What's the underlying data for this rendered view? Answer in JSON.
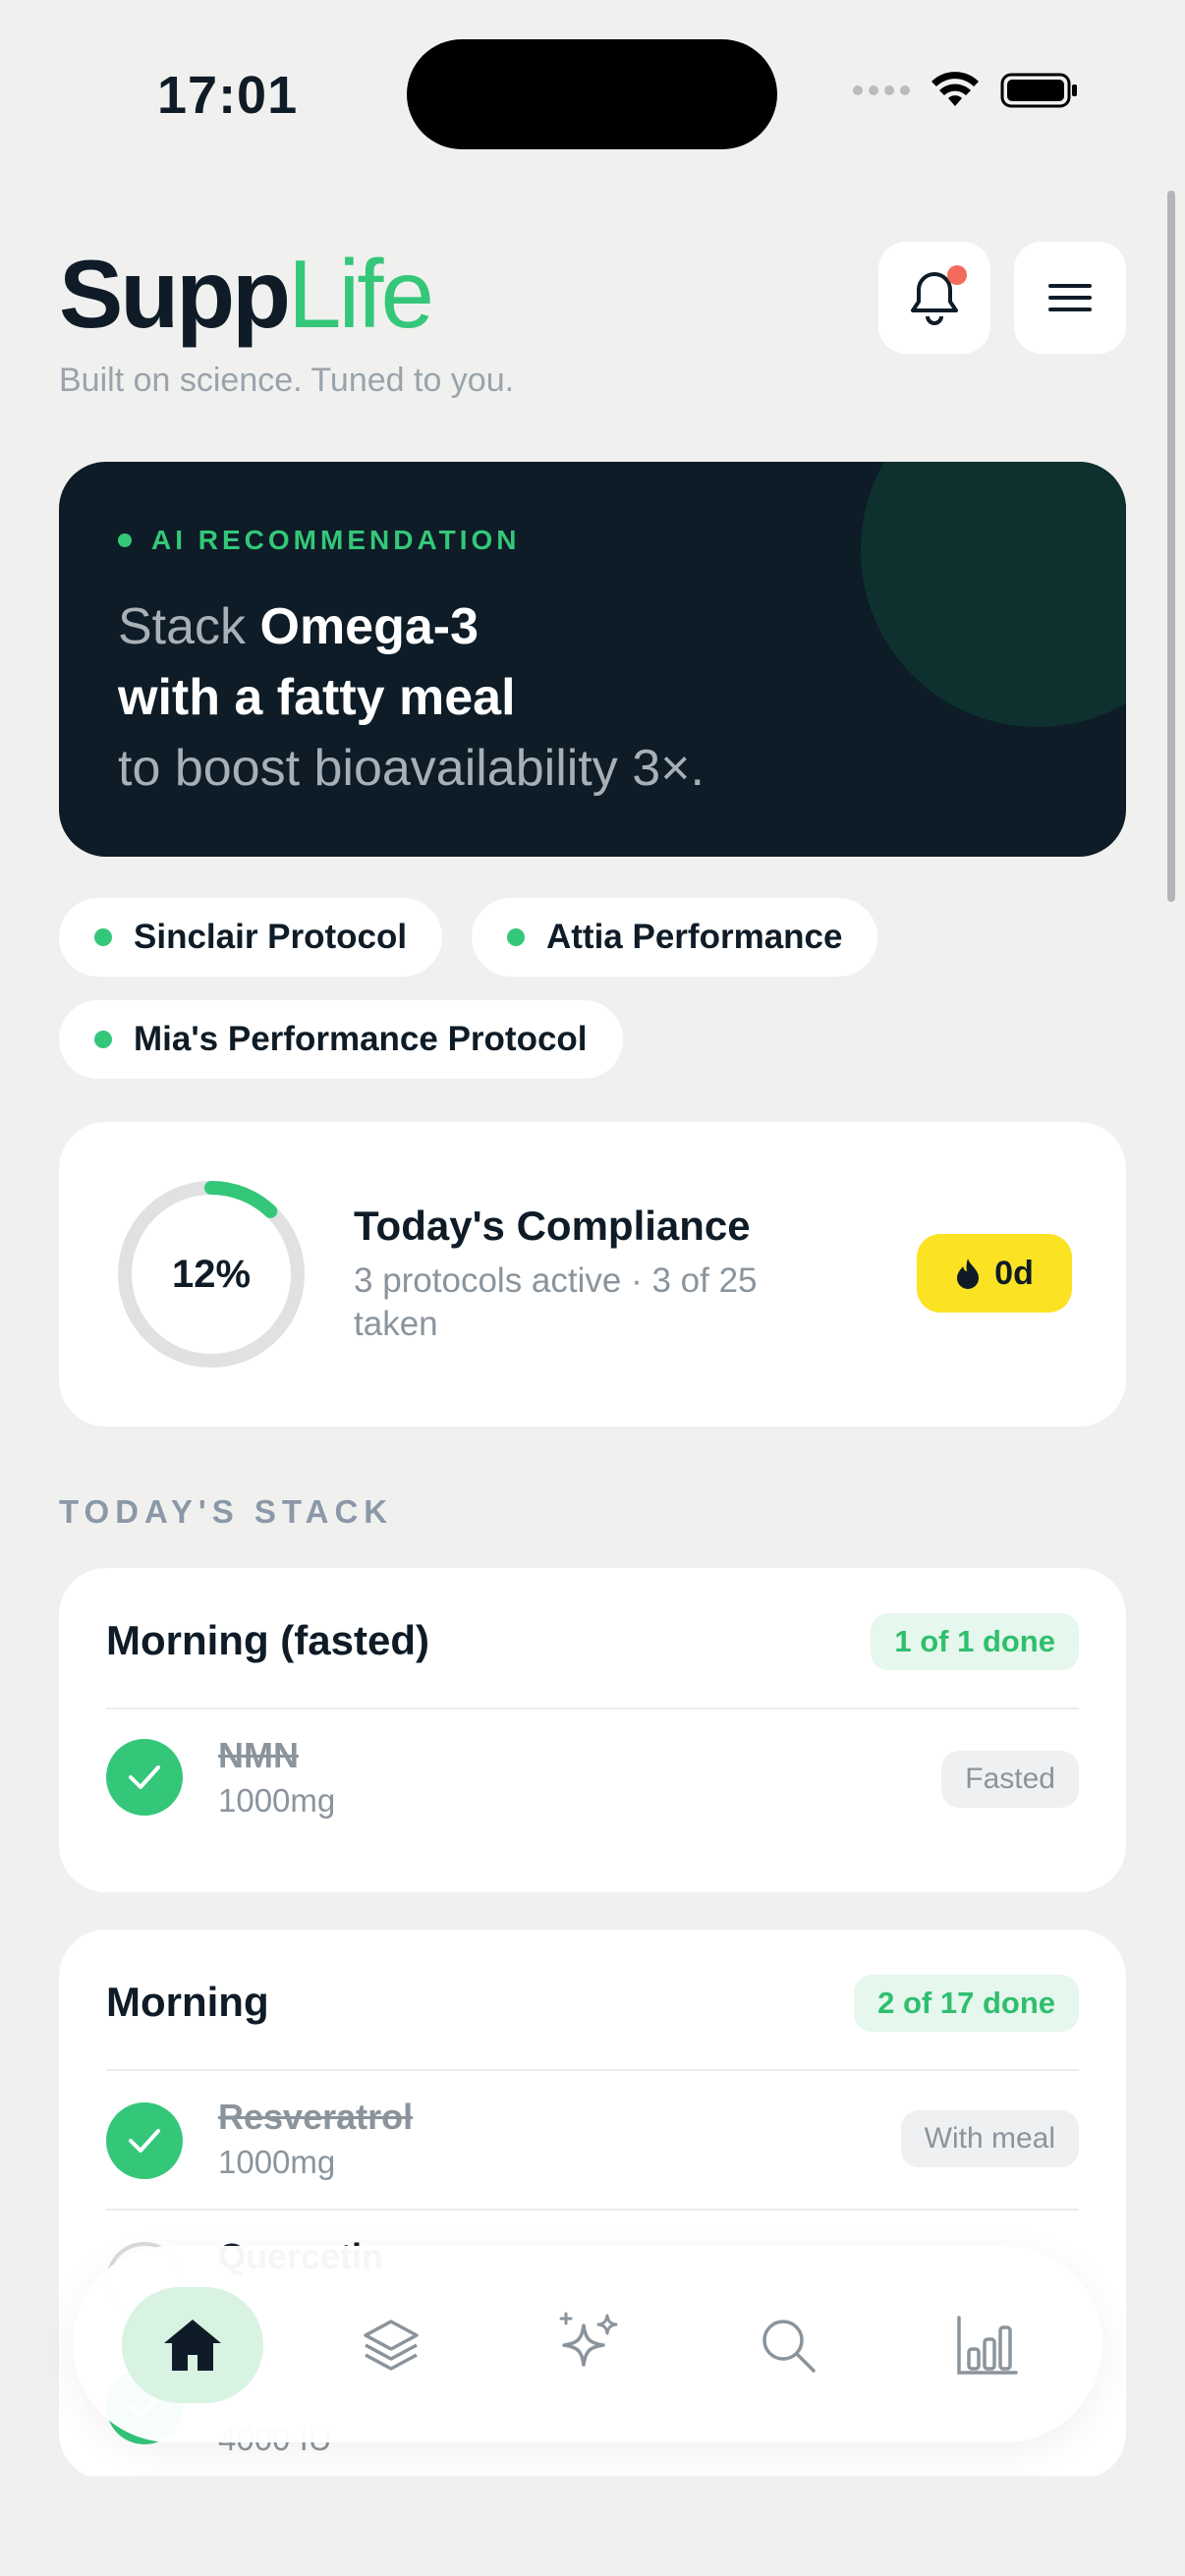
{
  "status_bar": {
    "time": "17:01"
  },
  "header": {
    "brand_bold": "Supp",
    "brand_light": "Life",
    "tagline": "Built on science. Tuned to you."
  },
  "ai_card": {
    "label": "AI RECOMMENDATION",
    "line1_prefix": "Stack ",
    "line1_bold": "Omega-3",
    "line2_bold": "with a fatty meal",
    "line3": "to boost bioavailability 3×."
  },
  "protocols": [
    {
      "label": "Sinclair Protocol"
    },
    {
      "label": "Attia Performance"
    },
    {
      "label": "Mia's Performance Protocol"
    }
  ],
  "compliance": {
    "percent_label": "12%",
    "percent_value": 12,
    "title": "Today's Compliance",
    "subtitle": "3 protocols active · 3 of 25 taken",
    "streak": "0d"
  },
  "section_title": "TODAY'S STACK",
  "stack": [
    {
      "slot": "Morning (fasted)",
      "badge": "1 of 1 done",
      "items": [
        {
          "name": "NMN",
          "dose": "1000mg",
          "tag": "Fasted",
          "done": true
        }
      ]
    },
    {
      "slot": "Morning",
      "badge": "2 of 17 done",
      "items": [
        {
          "name": "Resveratrol",
          "dose": "1000mg",
          "tag": "With meal",
          "done": true
        },
        {
          "name": "Quercetin",
          "dose": "",
          "tag": "",
          "done": false
        },
        {
          "name": "",
          "dose": "4000 IU",
          "tag": "",
          "done": true
        }
      ]
    }
  ],
  "nav": [
    {
      "name": "home-icon",
      "active": true
    },
    {
      "name": "layers-icon",
      "active": false
    },
    {
      "name": "sparkles-icon",
      "active": false
    },
    {
      "name": "search-icon",
      "active": false
    },
    {
      "name": "chart-icon",
      "active": false
    }
  ],
  "colors": {
    "accent": "#34c77a",
    "dark_card": "#0d1c26",
    "background": "#f0f1ef",
    "streak": "#fbe324",
    "notification": "#f26a5b"
  }
}
